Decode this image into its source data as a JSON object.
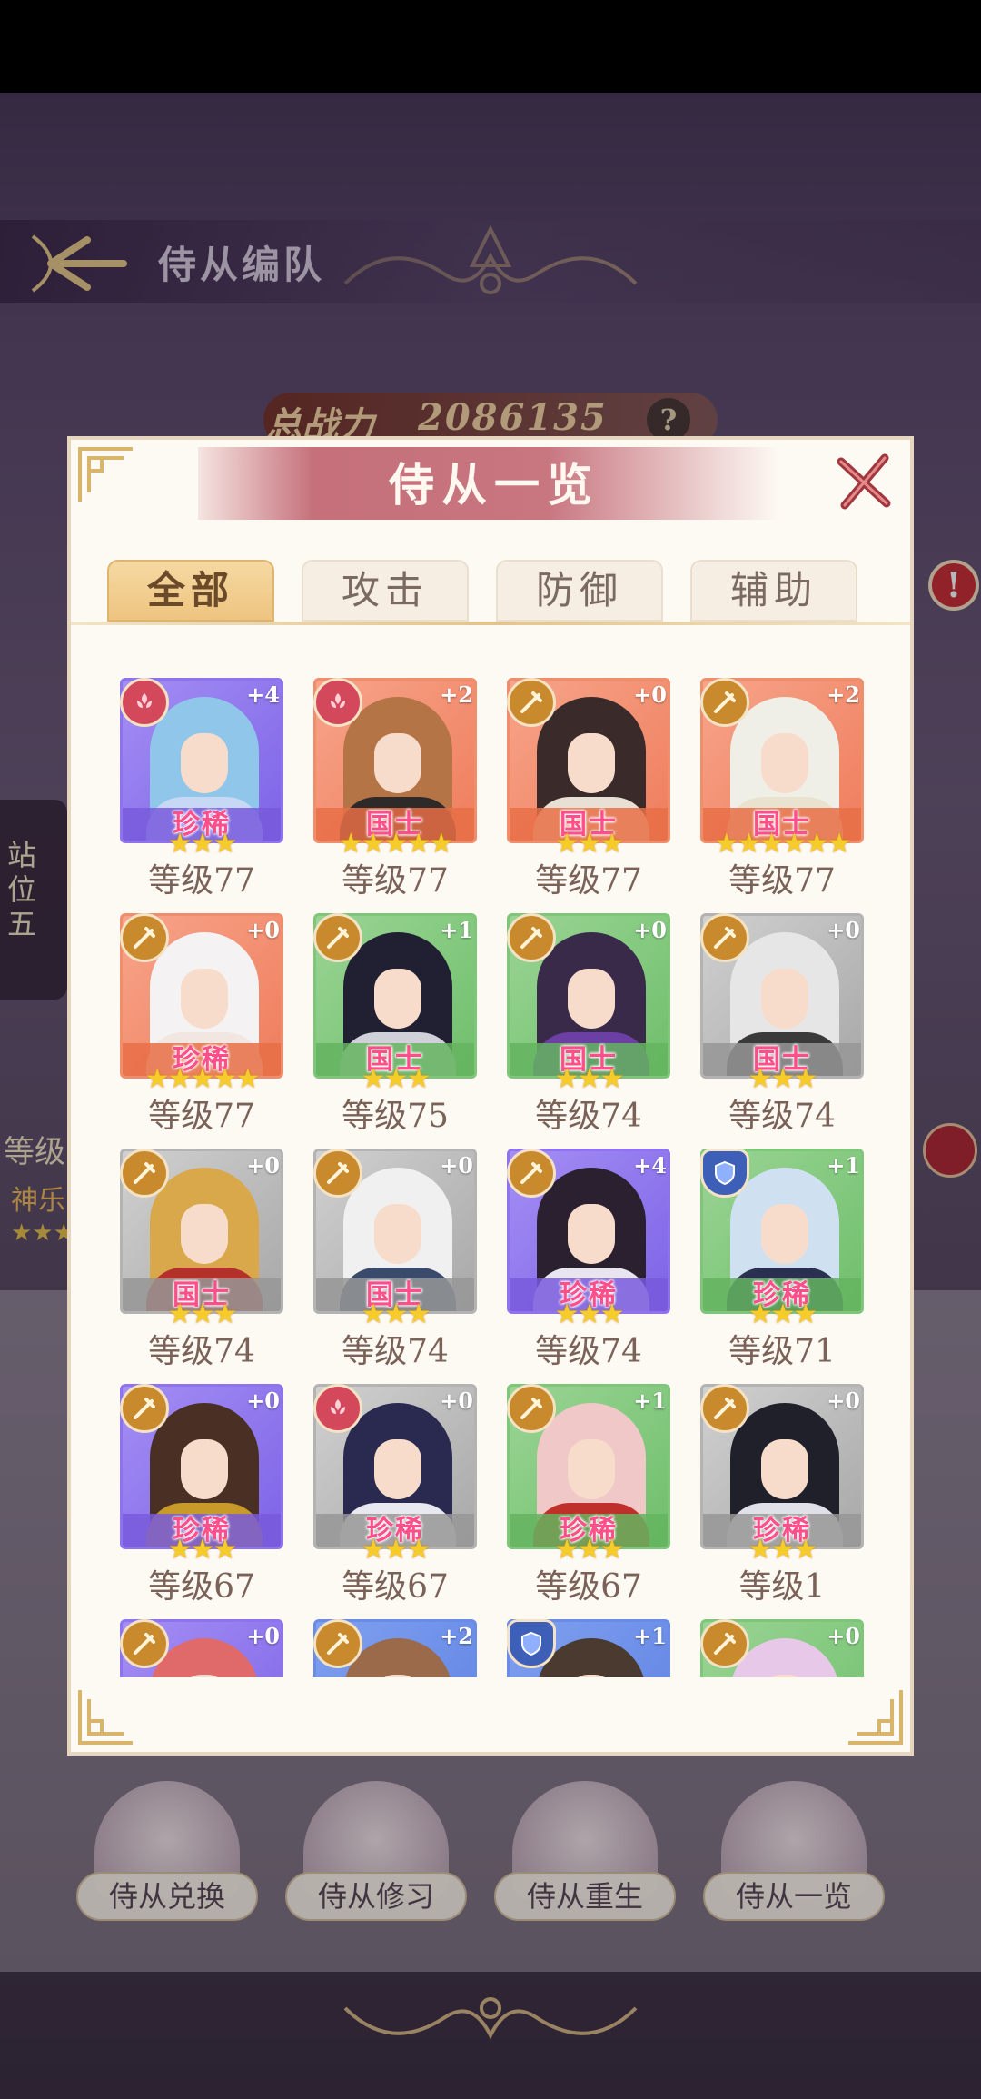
{
  "background": {
    "header_title": "侍从编队",
    "power_label": "总战力",
    "power_value": "2086135",
    "help": "?",
    "side_slot_label": "站位五",
    "side_level": "等级",
    "side_name": "神乐",
    "side_stars": "★★★",
    "alert": "!",
    "bottom_menu": [
      "侍从兑换",
      "侍从修习",
      "侍从重生",
      "侍从一览"
    ]
  },
  "modal": {
    "title": "侍从一览",
    "tabs": [
      "全部",
      "攻击",
      "防御",
      "辅助"
    ],
    "active_tab": 0,
    "cards": [
      {
        "color": "purple",
        "type": "support",
        "plus": "+4",
        "rarity": "珍稀",
        "stars": 3,
        "level": "等级77",
        "hair": "#8fc6ea",
        "body": "#c7d8f5"
      },
      {
        "color": "orange",
        "type": "support",
        "plus": "+2",
        "rarity": "国士",
        "stars": 5,
        "level": "等级77",
        "hair": "#b57446",
        "body": "#2f2a2a"
      },
      {
        "color": "orange",
        "type": "attack",
        "plus": "+0",
        "rarity": "国士",
        "stars": 3,
        "level": "等级77",
        "hair": "#3a2a2a",
        "body": "#e9e0d5"
      },
      {
        "color": "orange",
        "type": "attack",
        "plus": "+2",
        "rarity": "国士",
        "stars": 6,
        "level": "等级77",
        "hair": "#efefe8",
        "body": "#e9e2cf"
      },
      {
        "color": "orange",
        "type": "attack",
        "plus": "+0",
        "rarity": "珍稀",
        "stars": 5,
        "level": "等级77",
        "hair": "#f4f2f2",
        "body": "#f2e6e0"
      },
      {
        "color": "green",
        "type": "attack",
        "plus": "+1",
        "rarity": "国士",
        "stars": 3,
        "level": "等级75",
        "hair": "#202032",
        "body": "#cfd0d8"
      },
      {
        "color": "green",
        "type": "attack",
        "plus": "+0",
        "rarity": "国士",
        "stars": 3,
        "level": "等级74",
        "hair": "#3a2a4a",
        "body": "#6c3fa4"
      },
      {
        "color": "gray",
        "type": "attack",
        "plus": "+0",
        "rarity": "国士",
        "stars": 3,
        "level": "等级74",
        "hair": "#e6e6e6",
        "body": "#3a3a3a"
      },
      {
        "color": "gray",
        "type": "attack",
        "plus": "+0",
        "rarity": "国士",
        "stars": 3,
        "level": "等级74",
        "hair": "#d9a84a",
        "body": "#b4302a"
      },
      {
        "color": "gray",
        "type": "attack",
        "plus": "+0",
        "rarity": "国士",
        "stars": 3,
        "level": "等级74",
        "hair": "#f0f0f0",
        "body": "#3a4a6a"
      },
      {
        "color": "purple",
        "type": "attack",
        "plus": "+4",
        "rarity": "珍稀",
        "stars": 3,
        "level": "等级74",
        "hair": "#2a2030",
        "body": "#e8e4f0"
      },
      {
        "color": "green",
        "type": "defense",
        "plus": "+1",
        "rarity": "珍稀",
        "stars": 3,
        "level": "等级71",
        "hair": "#cfe0f0",
        "body": "#2a3050"
      },
      {
        "color": "purple",
        "type": "attack",
        "plus": "+0",
        "rarity": "珍稀",
        "stars": 3,
        "level": "等级67",
        "hair": "#4a3024",
        "body": "#c89a2a"
      },
      {
        "color": "gray",
        "type": "support",
        "plus": "+0",
        "rarity": "珍稀",
        "stars": 3,
        "level": "等级67",
        "hair": "#2a2a50",
        "body": "#e8e8f0"
      },
      {
        "color": "green",
        "type": "attack",
        "plus": "+1",
        "rarity": "珍稀",
        "stars": 3,
        "level": "等级67",
        "hair": "#f0c8c8",
        "body": "#c0302a"
      },
      {
        "color": "gray",
        "type": "attack",
        "plus": "+0",
        "rarity": "珍稀",
        "stars": 3,
        "level": "等级1",
        "hair": "#20202a",
        "body": "#e0e0e8"
      },
      {
        "color": "purple",
        "type": "attack",
        "plus": "+0",
        "rarity": "",
        "stars": 0,
        "level": "",
        "hair": "#e06a6a",
        "body": "#f0c0b0"
      },
      {
        "color": "blue",
        "type": "attack",
        "plus": "+2",
        "rarity": "",
        "stars": 0,
        "level": "",
        "hair": "#9a6a4a",
        "body": "#f0d0c0"
      },
      {
        "color": "blue",
        "type": "defense",
        "plus": "+1",
        "rarity": "",
        "stars": 0,
        "level": "",
        "hair": "#4a3a30",
        "body": "#f0d0c0"
      },
      {
        "color": "green",
        "type": "attack",
        "plus": "+0",
        "rarity": "",
        "stars": 0,
        "level": "",
        "hair": "#e8c8e8",
        "body": "#f0e0e8"
      }
    ]
  }
}
